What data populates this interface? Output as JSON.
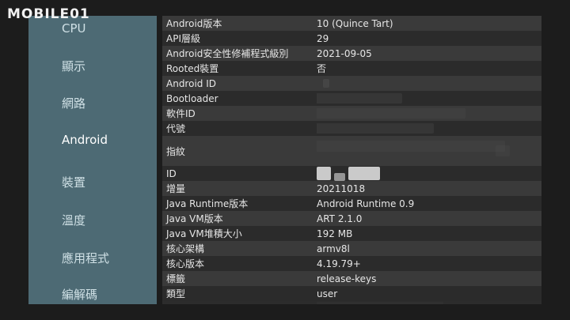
{
  "watermark": {
    "text": "MOBILE01"
  },
  "sidebar": {
    "items": [
      {
        "label": "CPU",
        "active": false
      },
      {
        "label": "顯示",
        "active": false
      },
      {
        "label": "網路",
        "active": false
      },
      {
        "label": "Android",
        "active": true
      },
      {
        "label": "裝置",
        "active": false
      },
      {
        "label": "溫度",
        "active": false
      },
      {
        "label": "應用程式",
        "active": false
      },
      {
        "label": "編解碼",
        "active": false
      }
    ]
  },
  "info": {
    "rows": [
      {
        "key": "Android版本",
        "value": "10 (Quince Tart)"
      },
      {
        "key": "API層級",
        "value": "29"
      },
      {
        "key": "Android安全性修補程式級別",
        "value": "2021-09-05"
      },
      {
        "key": "Rooted裝置",
        "value": "否"
      },
      {
        "key": "Android ID",
        "value": ""
      },
      {
        "key": "Bootloader",
        "value": ""
      },
      {
        "key": "軟件ID",
        "value": ""
      },
      {
        "key": "代號",
        "value": ""
      },
      {
        "key": "指紋",
        "value": ""
      },
      {
        "key": "ID",
        "value": ""
      },
      {
        "key": "增量",
        "value": "20211018"
      },
      {
        "key": "Java Runtime版本",
        "value": "Android Runtime 0.9"
      },
      {
        "key": "Java VM版本",
        "value": "ART 2.1.0"
      },
      {
        "key": "Java VM堆積大小",
        "value": "192 MB"
      },
      {
        "key": "核心架構",
        "value": "armv8l"
      },
      {
        "key": "核心版本",
        "value": "4.19.79+"
      },
      {
        "key": "標籤",
        "value": "release-keys"
      },
      {
        "key": "類型",
        "value": "user"
      }
    ]
  }
}
